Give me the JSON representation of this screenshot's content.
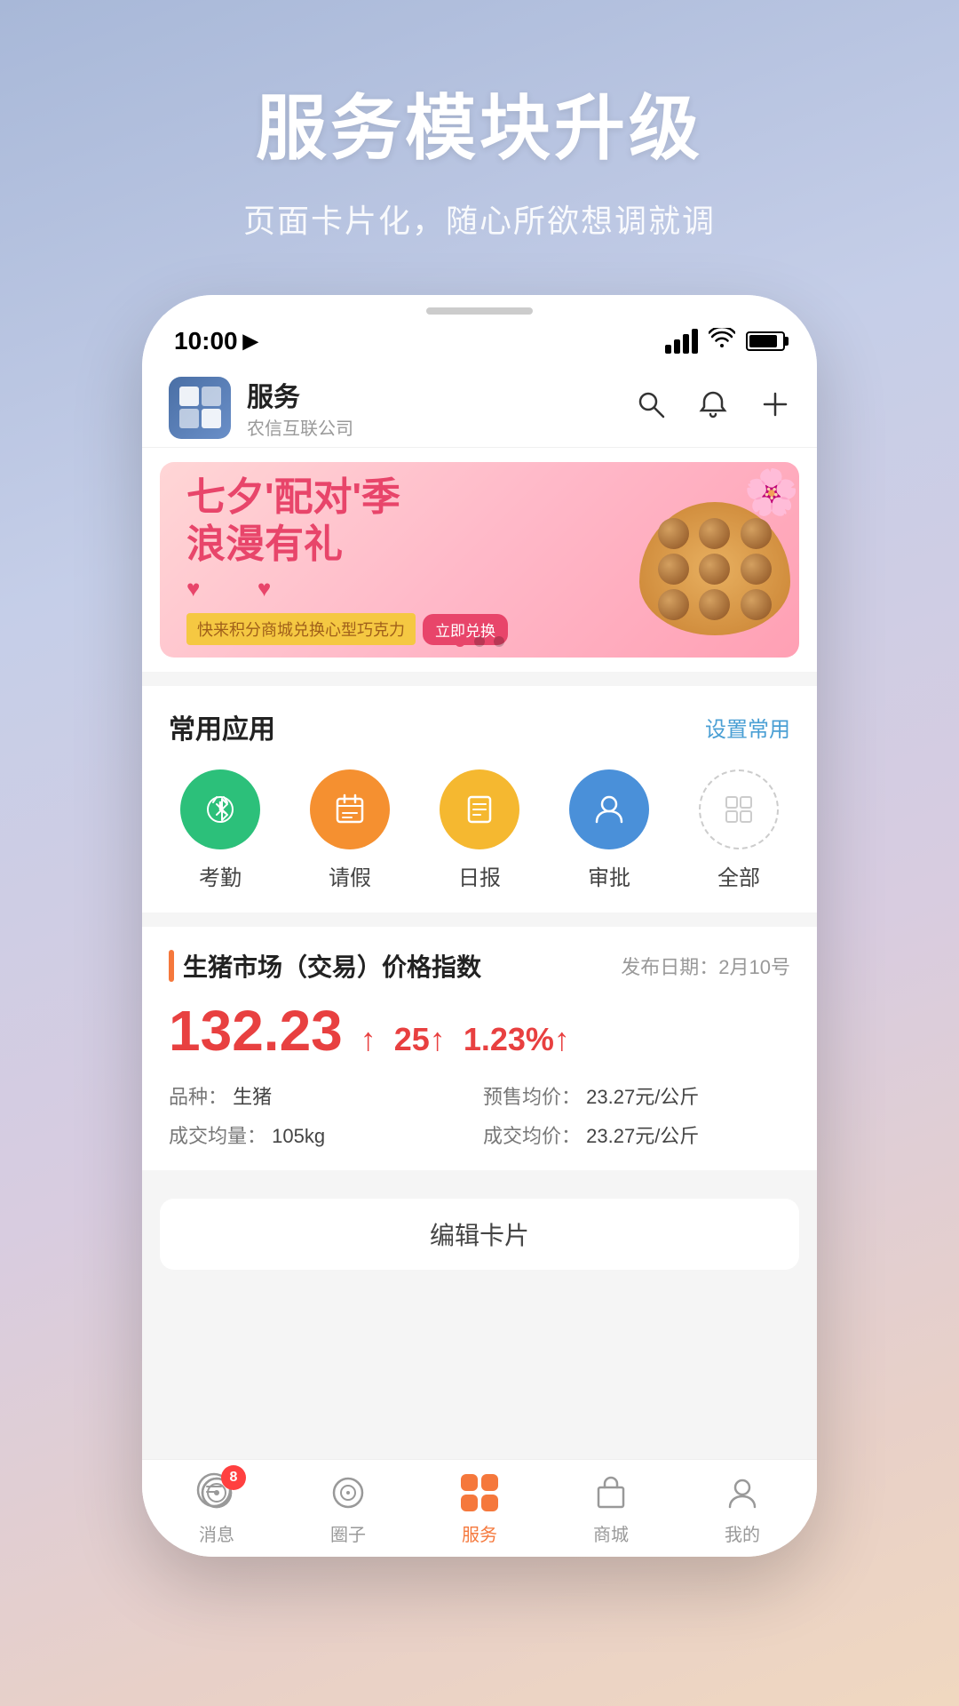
{
  "background": {
    "title": "服务模块升级",
    "subtitle": "页面卡片化，随心所欲想调就调"
  },
  "phone": {
    "status_bar": {
      "time": "10:00",
      "location_icon": "▶",
      "signal_label": "signal",
      "wifi_label": "wifi",
      "battery_label": "battery"
    },
    "header": {
      "app_name": "服务",
      "company_name": "农信互联公司",
      "search_icon": "search",
      "bell_icon": "bell",
      "add_icon": "plus"
    },
    "banner": {
      "title_line1": "七夕'配对'季",
      "title_line2": "浪漫有礼",
      "subtitle": "快来积分商城兑换心型巧克力",
      "exchange_btn": "立即兑换",
      "dots": [
        "active",
        "inactive",
        "inactive"
      ]
    },
    "common_apps": {
      "title": "常用应用",
      "action": "设置常用",
      "apps": [
        {
          "label": "考勤",
          "icon_type": "bluetooth",
          "color": "green"
        },
        {
          "label": "请假",
          "icon_type": "calendar",
          "color": "orange"
        },
        {
          "label": "日报",
          "icon_type": "report",
          "color": "yellow"
        },
        {
          "label": "审批",
          "icon_type": "person",
          "color": "blue"
        },
        {
          "label": "全部",
          "icon_type": "grid",
          "color": "outline"
        }
      ]
    },
    "market_card": {
      "title": "生猪市场（交易）价格指数",
      "date_label": "发布日期：",
      "date_value": "2月10号",
      "price": "132.23",
      "up_arrow": "↑",
      "change_value": "25",
      "change_pct": "1.23%",
      "change_pct_arrow": "↑",
      "variety_label": "品种：",
      "variety_value": "生猪",
      "volume_label": "成交均量：",
      "volume_value": "105kg",
      "presale_price_label": "预售均价：",
      "presale_price_value": "23.27元/公斤",
      "trade_price_label": "成交均价：",
      "trade_price_value": "23.27元/公斤"
    },
    "edit_card": {
      "label": "编辑卡片"
    },
    "bottom_nav": {
      "items": [
        {
          "label": "消息",
          "icon": "message",
          "badge": "8",
          "active": false
        },
        {
          "label": "圈子",
          "icon": "circle",
          "badge": "",
          "active": false
        },
        {
          "label": "服务",
          "icon": "apps",
          "badge": "",
          "active": true
        },
        {
          "label": "商城",
          "icon": "shop",
          "badge": "",
          "active": false
        },
        {
          "label": "我的",
          "icon": "person",
          "badge": "",
          "active": false
        }
      ]
    }
  }
}
